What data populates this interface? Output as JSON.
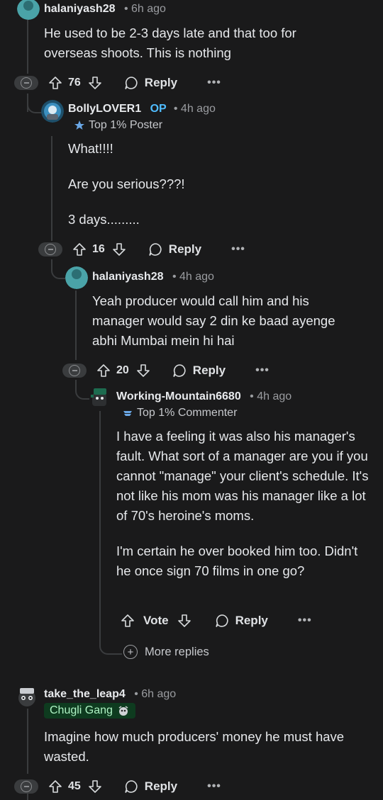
{
  "comments": [
    {
      "username": "halaniyash28",
      "time": "6h ago",
      "body": [
        "He used to be 2-3 days late and that too for overseas shoots. This is nothing"
      ],
      "votes": "76",
      "reply_label": "Reply",
      "more_label": "•••"
    },
    {
      "username": "BollyLOVER1",
      "op_label": "OP",
      "time": "4h ago",
      "flair": "Top 1% Poster",
      "body": [
        "What!!!!",
        "Are you serious???!",
        "3 days........."
      ],
      "votes": "16",
      "reply_label": "Reply",
      "more_label": "•••"
    },
    {
      "username": "halaniyash28",
      "time": "4h ago",
      "body": [
        "Yeah producer would call him and his manager would say 2 din ke baad ayenge abhi Mumbai mein hi hai"
      ],
      "votes": "20",
      "reply_label": "Reply",
      "more_label": "•••"
    },
    {
      "username": "Working-Mountain6680",
      "time": "4h ago",
      "flair": "Top 1% Commenter",
      "body": [
        "I have a feeling it was also his manager's fault. What sort of a manager are you if you cannot \"manage\" your client's schedule. It's not like his mom was his manager like a lot of 70's heroine's moms.",
        "I'm certain he over booked him too. Didn't he once sign 70 films in one go?"
      ],
      "votes": "Vote",
      "reply_label": "Reply",
      "more_label": "•••"
    },
    {
      "username": "take_the_leap4",
      "time": "6h ago",
      "flair": "Chugli Gang",
      "body": [
        "Imagine how much producers' money he must have wasted."
      ],
      "votes": "45",
      "reply_label": "Reply",
      "more_label": "•••"
    }
  ],
  "more_replies_label": "More replies",
  "colors": {
    "background": "#1a1a1b",
    "op": "#4fbcff",
    "thread_line": "#3a3c3e",
    "flair_bg": "#0e3b1f"
  }
}
